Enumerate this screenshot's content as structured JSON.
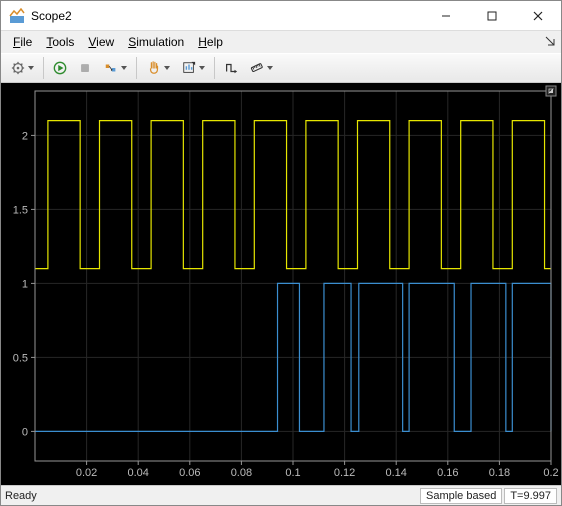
{
  "window": {
    "title": "Scope2"
  },
  "menus": {
    "file": "File",
    "tools": "Tools",
    "view": "View",
    "simulation": "Simulation",
    "help": "Help"
  },
  "status": {
    "ready": "Ready",
    "mode": "Sample based",
    "time": "T=9.997"
  },
  "colors": {
    "series1": "#e6e600",
    "series2": "#3b8ed0",
    "axis": "#969696",
    "grid": "#272727",
    "plot_bg": "#000000"
  },
  "chart_data": {
    "type": "line",
    "xlabel": "",
    "ylabel": "",
    "xlim": [
      0,
      0.2
    ],
    "ylim": [
      -0.2,
      2.3
    ],
    "xticks": [
      0.02,
      0.04,
      0.06,
      0.08,
      0.1,
      0.12,
      0.14,
      0.16,
      0.18,
      0.2
    ],
    "yticks": [
      0,
      0.5,
      1,
      1.5,
      2
    ],
    "series": [
      {
        "name": "signal-1-yellow",
        "low": 1.1,
        "high": 2.1,
        "edges": [
          0.005,
          0.0175,
          0.025,
          0.0375,
          0.045,
          0.0575,
          0.065,
          0.0775,
          0.085,
          0.0975,
          0.105,
          0.1175,
          0.125,
          0.1375,
          0.145,
          0.1575,
          0.165,
          0.1775,
          0.185,
          0.1975
        ]
      },
      {
        "name": "signal-2-blue",
        "low": 0.0,
        "high": 1.0,
        "edges": [
          0.094,
          0.1025,
          0.112,
          0.1225,
          0.1255,
          0.1425,
          0.145,
          0.1625,
          0.169,
          0.1825,
          0.185,
          0.2
        ]
      }
    ]
  }
}
